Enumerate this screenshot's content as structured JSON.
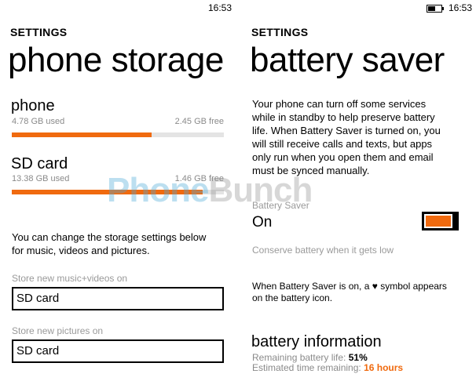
{
  "left_screen": {
    "status_time": "16:53",
    "section_header": "SETTINGS",
    "page_title": "phone storage",
    "phone": {
      "name": "phone",
      "used": "4.78 GB used",
      "free": "2.45 GB free",
      "used_fraction": 0.66
    },
    "sd_card": {
      "name": "SD card",
      "used": "13.38 GB used",
      "free": "1.46 GB free",
      "used_fraction": 0.9
    },
    "info_text_line1": "You can change the storage settings below",
    "info_text_line2": "for music, videos and pictures.",
    "music_label": "Store new music+videos on",
    "music_value": "SD card",
    "pictures_label": "Store new pictures on",
    "pictures_value": "SD card"
  },
  "right_screen": {
    "status_time": "16:53",
    "section_header": "SETTINGS",
    "page_title": "battery saver",
    "description_lines": [
      "Your phone can turn off some services",
      "while in standby to help preserve battery",
      "life. When Battery Saver is turned on, you",
      "will still receive calls and texts, but apps",
      "only run when you open them and email",
      "must be synced manually."
    ],
    "toggle_label": "Battery Saver",
    "toggle_state": "On",
    "conserve_text": "Conserve battery when it gets low",
    "symbol_note_line1_a": "When Battery Saver is on, a",
    "symbol_note_heart": "♥",
    "symbol_note_line1_b": "symbol appears",
    "symbol_note_line2": "on the battery icon.",
    "info_heading": "battery information",
    "remaining_label": "Remaining battery life:",
    "remaining_value": "51%",
    "estimated_label": "Estimated time remaining:",
    "estimated_value": "16 hours"
  },
  "watermark": {
    "part1": "Phone",
    "part2": "Bunch"
  },
  "colors": {
    "accent": "#f06a0f",
    "bar_track": "#e4e4e4",
    "secondary_text": "#8a8a8a"
  }
}
